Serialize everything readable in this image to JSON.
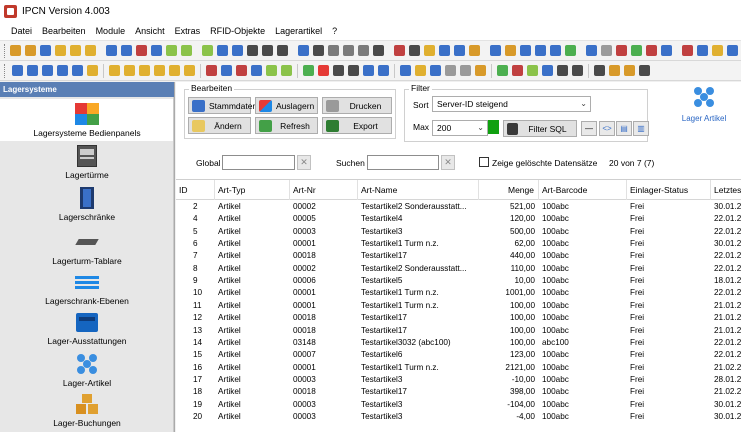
{
  "window": {
    "title": "IPCN Version 4.003"
  },
  "menu": [
    "Datei",
    "Bearbeiten",
    "Module",
    "Ansicht",
    "Extras",
    "RFID-Objekte",
    "Lagerartikel",
    "?"
  ],
  "toolbar1_colors": [
    "#d89a2a",
    "#d89a2a",
    "#3a70c8",
    "#e0b030",
    "#e0b030",
    "#e0b030",
    "#3a70c8",
    "#3a70c8",
    "#c04040",
    "#3a70c8",
    "#8bc34a",
    "#8bc34a",
    "#8bc34a",
    "#3a70c8",
    "#3a70c8",
    "#4a4a4a",
    "#4a4a4a",
    "#4a4a4a",
    "#3a70c8",
    "#4a4a4a",
    "#7a7a7a",
    "#7a7a7a",
    "#7a7a7a",
    "#4a4a4a",
    "#c04040",
    "#4a4a4a",
    "#e0b030",
    "#3a70c8",
    "#3a70c8",
    "#d89a2a",
    "#3a70c8",
    "#d89a2a",
    "#3a70c8",
    "#3a70c8",
    "#3a70c8",
    "#4caf50",
    "#3a70c8",
    "#9a9a9a",
    "#c04040",
    "#4caf50",
    "#c04040",
    "#3a70c8",
    "#c04040",
    "#3a70c8",
    "#e0b030",
    "#3a70c8",
    "#e0b030",
    "#3a70c8"
  ],
  "toolbar2_colors": [
    "#3a70c8",
    "#3a70c8",
    "#3a70c8",
    "#3a70c8",
    "#3a70c8",
    "#e0b030",
    "#e0b030",
    "#e0b030",
    "#e0b030",
    "#e0b030",
    "#e0b030",
    "#e0b030",
    "#c04040",
    "#3a70c8",
    "#c04040",
    "#3a70c8",
    "#8bc34a",
    "#8bc34a",
    "#4caf50",
    "#e53935",
    "#4a4a4a",
    "#4a4a4a",
    "#3a70c8",
    "#3a70c8",
    "#3a70c8",
    "#e0b030",
    "#3a70c8",
    "#9a9a9a",
    "#9a9a9a",
    "#d89a2a",
    "#4caf50",
    "#c04040",
    "#8bc34a",
    "#3a70c8",
    "#4a4a4a",
    "#4a4a4a",
    "#4a4a4a",
    "#d89a2a",
    "#d89a2a",
    "#4a4a4a"
  ],
  "sidebar": {
    "header": "Lagersysteme",
    "items": [
      {
        "label": "Lagersysteme Bedienpanels",
        "icon": "bedienpanel-icon",
        "active": true
      },
      {
        "label": "Lagertürme",
        "icon": "lagerturm-icon"
      },
      {
        "label": "Lagerschränke",
        "icon": "lagerschrank-icon"
      },
      {
        "label": "Lagerturm-Tablare",
        "icon": "tablar-icon"
      },
      {
        "label": "Lagerschrank-Ebenen",
        "icon": "ebenen-icon"
      },
      {
        "label": "Lager-Ausstattungen",
        "icon": "ausstattung-icon"
      },
      {
        "label": "Lager-Artikel",
        "icon": "lager-artikel-icon"
      },
      {
        "label": "Lager-Buchungen",
        "icon": "buchungen-icon"
      }
    ]
  },
  "bearbeiten": {
    "title": "Bearbeiten",
    "stammdaten": "Stammdaten",
    "auslagern": "Auslagern",
    "drucken": "Drucken",
    "aendern": "Ändern",
    "refresh": "Refresh",
    "export": "Export"
  },
  "filter": {
    "title": "Filter",
    "sort_label": "Sort",
    "sort_value": "Server-ID steigend",
    "max_label": "Max",
    "max_value": "200",
    "filter_sql": "Filter SQL"
  },
  "lager_artikel_label": "Lager Artikel",
  "search": {
    "global_label": "Global",
    "suchen_label": "Suchen",
    "clear_glyph": "✕",
    "show_deleted_label": "Zeige gelöschte Datensätze",
    "count": "20 von 7 (7)"
  },
  "table": {
    "columns": [
      "ID",
      "Art-Typ",
      "Art-Nr",
      "Art-Name",
      "Menge",
      "Art-Barcode",
      "Einlager-Status",
      "Letztes"
    ],
    "rows": [
      [
        "2",
        "Artikel",
        "00002",
        "Testartikel2 Sonderausstatt...",
        "521,00",
        "100abc",
        "Frei",
        "30.01.2"
      ],
      [
        "4",
        "Artikel",
        "00005",
        "Testartikel4",
        "120,00",
        "100abc",
        "Frei",
        "22.01.2"
      ],
      [
        "5",
        "Artikel",
        "00003",
        "Testartikel3",
        "500,00",
        "100abc",
        "Frei",
        "22.01.2"
      ],
      [
        "6",
        "Artikel",
        "00001",
        "Testartikel1 Turm n.z.",
        "62,00",
        "100abc",
        "Frei",
        "30.01.2"
      ],
      [
        "7",
        "Artikel",
        "00018",
        "Testartikel17",
        "440,00",
        "100abc",
        "Frei",
        "22.01.2"
      ],
      [
        "8",
        "Artikel",
        "00002",
        "Testartikel2 Sonderausstatt...",
        "110,00",
        "100abc",
        "Frei",
        "22.01.2"
      ],
      [
        "9",
        "Artikel",
        "00006",
        "Testartikel5",
        "10,00",
        "100abc",
        "Frei",
        "18.01.2"
      ],
      [
        "10",
        "Artikel",
        "00001",
        "Testartikel1 Turm n.z.",
        "1001,00",
        "100abc",
        "Frei",
        "22.01.2"
      ],
      [
        "11",
        "Artikel",
        "00001",
        "Testartikel1 Turm n.z.",
        "100,00",
        "100abc",
        "Frei",
        "21.01.2"
      ],
      [
        "12",
        "Artikel",
        "00018",
        "Testartikel17",
        "100,00",
        "100abc",
        "Frei",
        "21.01.2"
      ],
      [
        "13",
        "Artikel",
        "00018",
        "Testartikel17",
        "100,00",
        "100abc",
        "Frei",
        "21.01.2"
      ],
      [
        "14",
        "Artikel",
        "03148",
        "Testartikel3032 (abc100)",
        "100,00",
        "abc100",
        "Frei",
        "22.01.2"
      ],
      [
        "15",
        "Artikel",
        "00007",
        "Testartikel6",
        "123,00",
        "100abc",
        "Frei",
        "22.01.2"
      ],
      [
        "16",
        "Artikel",
        "00001",
        "Testartikel1 Turm n.z.",
        "2121,00",
        "100abc",
        "Frei",
        "21.02.2"
      ],
      [
        "17",
        "Artikel",
        "00003",
        "Testartikel3",
        "-10,00",
        "100abc",
        "Frei",
        "28.01.2"
      ],
      [
        "18",
        "Artikel",
        "00018",
        "Testartikel17",
        "398,00",
        "100abc",
        "Frei",
        "21.02.2"
      ],
      [
        "19",
        "Artikel",
        "00003",
        "Testartikel3",
        "-104,00",
        "100abc",
        "Frei",
        "30.01.2"
      ],
      [
        "20",
        "Artikel",
        "00003",
        "Testartikel3",
        "-4,00",
        "100abc",
        "Frei",
        "30.01.2"
      ]
    ]
  }
}
